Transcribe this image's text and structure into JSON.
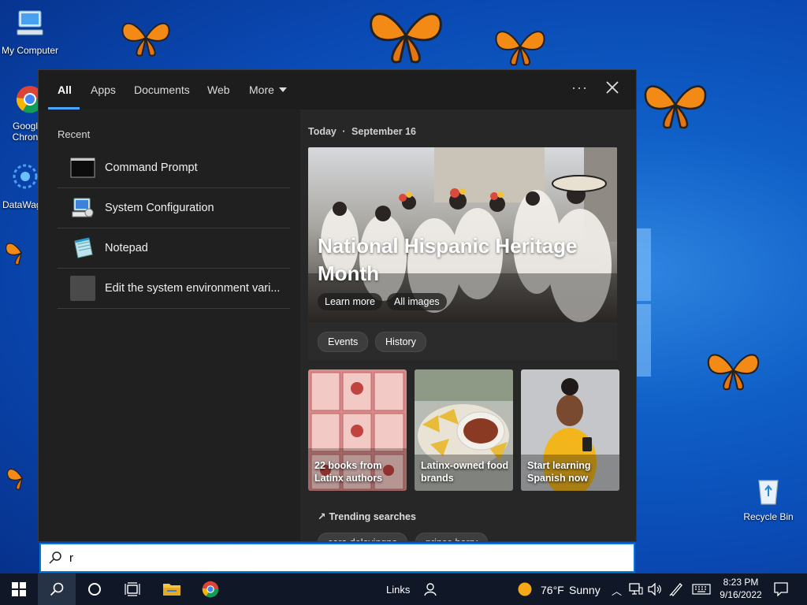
{
  "desktop": {
    "icons": [
      {
        "label": "My Computer"
      },
      {
        "label": "Googl Chron"
      },
      {
        "label": "DataWag"
      },
      {
        "label": "Recycle Bin"
      }
    ]
  },
  "search_panel": {
    "tabs": [
      {
        "label": "All",
        "active": true
      },
      {
        "label": "Apps"
      },
      {
        "label": "Documents"
      },
      {
        "label": "Web"
      },
      {
        "label": "More"
      }
    ],
    "more_options_icon": "ellipsis-icon",
    "close_icon": "close-icon",
    "recent": {
      "title": "Recent",
      "items": [
        {
          "label": "Command Prompt",
          "icon": "command-prompt-icon"
        },
        {
          "label": "System Configuration",
          "icon": "system-configuration-icon"
        },
        {
          "label": "Notepad",
          "icon": "notepad-icon"
        },
        {
          "label": "Edit the system environment vari...",
          "icon": "settings-icon"
        }
      ]
    },
    "highlights": {
      "today_label": "Today",
      "date": "September 16",
      "hero": {
        "title": "National Hispanic Heritage Month",
        "learn_more": "Learn more",
        "all_images": "All images"
      },
      "topics": [
        "Events",
        "History"
      ],
      "cards": [
        {
          "label": "22 books from Latinx authors"
        },
        {
          "label": "Latinx-owned food brands"
        },
        {
          "label": "Start learning Spanish now"
        }
      ],
      "trending_title": "Trending searches",
      "trending": [
        "cara delevingne",
        "prince harry"
      ]
    },
    "search_input": {
      "value": "r",
      "placeholder": ""
    }
  },
  "taskbar": {
    "links_label": "Links",
    "weather": {
      "temp": "76°F",
      "condition": "Sunny"
    },
    "clock": {
      "time": "8:23 PM",
      "date": "9/16/2022"
    }
  },
  "colors": {
    "accent": "#0078d7",
    "panel_bg": "#202020",
    "taskbar_bg": "#101827"
  }
}
